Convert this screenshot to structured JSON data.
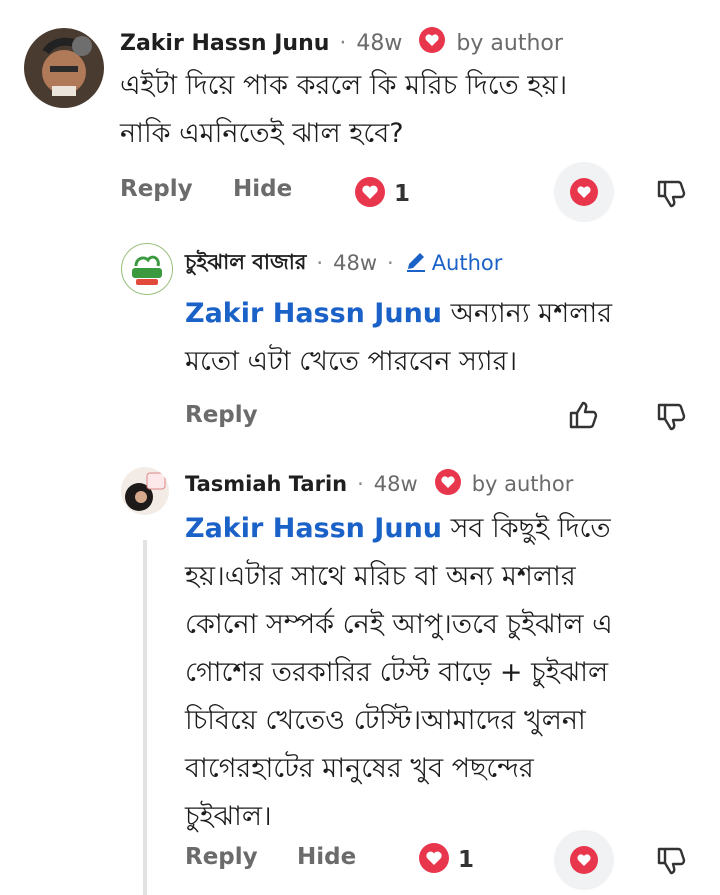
{
  "comments": [
    {
      "author": "Zakir Hassn Junu",
      "time": "48w",
      "badge": "by author",
      "text_lines": [
        "এইটা দিয়ে পাক করলে কি মরিচ দিতে হয়।",
        "নাকি এমনিতেই ঝাল হবে?"
      ],
      "actions": {
        "reply": "Reply",
        "hide": "Hide"
      },
      "reaction_count": "1"
    },
    {
      "author": "চুইঝাল বাজার",
      "avatar_text": "চুইঝাল বাজার",
      "time": "48w",
      "badge": "Author",
      "mention": "Zakir Hassn Junu",
      "text_first": " অন্যান্য মশলার",
      "text_lines": [
        "মতো এটা খেতে পারবেন স্যার।"
      ],
      "actions": {
        "reply": "Reply"
      }
    },
    {
      "author": "Tasmiah Tarin",
      "time": "48w",
      "badge": "by author",
      "mention": "Zakir Hassn Junu",
      "text_first": " সব কিছুই দিতে",
      "text_lines": [
        "হয়।এটার সাথে মরিচ বা অন্য মশলার",
        "কোনো সম্পর্ক নেই আপু।তবে চুইঝাল এ",
        "গোশের তরকারির টেস্ট বাড়ে + চুইঝাল",
        "চিবিয়ে খেতেও টেস্টি।আমাদের খুলনা",
        "বাগেরহাটের মানুষের খুব পছন্দের",
        "চুইঝাল।"
      ],
      "actions": {
        "reply": "Reply",
        "hide": "Hide"
      },
      "reaction_count": "1"
    }
  ],
  "colors": {
    "accent_blue": "#1b62c8",
    "heart_red": "#e8364d"
  },
  "icons": [
    "heart-badge-icon",
    "heart-icon",
    "dislike-icon",
    "like-icon",
    "pencil-icon"
  ]
}
